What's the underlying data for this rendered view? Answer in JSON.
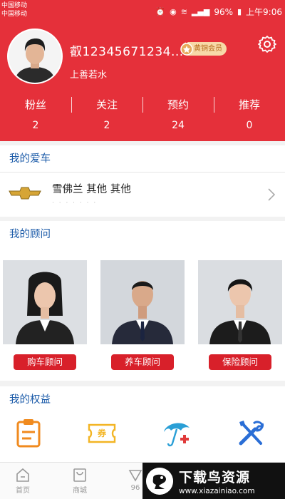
{
  "status_bar": {
    "carrier_1": "中国移动",
    "carrier_2": "中国移动",
    "battery": "96%",
    "time": "上午9:06"
  },
  "profile": {
    "username": "叡12345671234...",
    "member_badge": "黄铜会员",
    "nickname": "上善若水"
  },
  "stats": [
    {
      "label": "粉丝",
      "value": "2"
    },
    {
      "label": "关注",
      "value": "2"
    },
    {
      "label": "预约",
      "value": "24"
    },
    {
      "label": "推荐",
      "value": "0"
    }
  ],
  "my_car": {
    "title": "我的爱车",
    "car_name": "雪佛兰 其他 其他",
    "car_sub": "· · · · · · ·"
  },
  "my_advisors": {
    "title": "我的顾问",
    "buttons": [
      "购车顾问",
      "养车顾问",
      "保险顾问"
    ]
  },
  "my_rights": {
    "title": "我的权益",
    "coupon_label": "券",
    "icons": [
      "clipboard-icon",
      "coupon-icon",
      "umbrella-insurance-icon",
      "tools-icon"
    ]
  },
  "tabbar": {
    "tabs": [
      "首页",
      "商城",
      "96"
    ]
  },
  "watermark": {
    "title": "下载鸟资源",
    "url": "www.xiazainiao.com"
  },
  "colors": {
    "header_red": "#e5303a",
    "section_title_blue": "#1a5aa8",
    "button_red": "#d8202a",
    "badge_gold": "#f7d9a8"
  }
}
